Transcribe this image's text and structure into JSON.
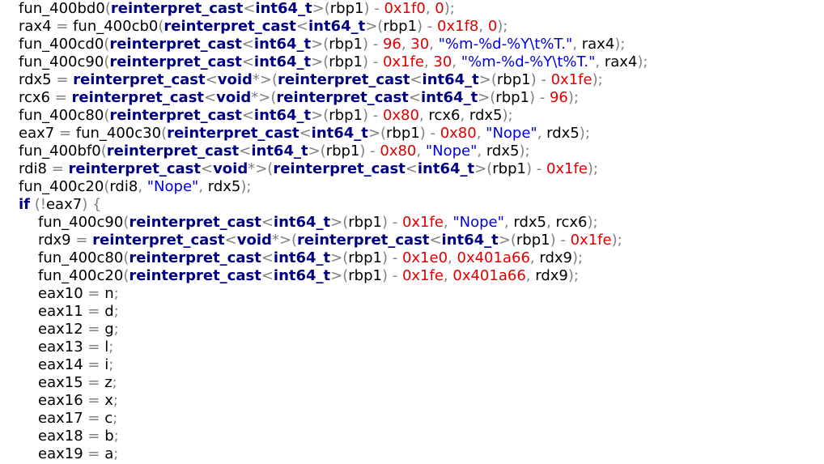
{
  "code_view": {
    "lines": [
      {
        "indent": 0,
        "tokens": [
          [
            "plain",
            "fun_400bd0"
          ],
          [
            "punct",
            "("
          ],
          [
            "kw",
            "reinterpret_cast"
          ],
          [
            "punct",
            "<"
          ],
          [
            "kw",
            "int64_t"
          ],
          [
            "punct",
            ">("
          ],
          [
            "plain",
            "rbp1"
          ],
          [
            "punct",
            ") - "
          ],
          [
            "num",
            "0x1f0"
          ],
          [
            "punct",
            ", "
          ],
          [
            "num",
            "0"
          ],
          [
            "punct",
            ");"
          ]
        ]
      },
      {
        "indent": 0,
        "tokens": [
          [
            "plain",
            "rax4"
          ],
          [
            "punct",
            " = "
          ],
          [
            "plain",
            "fun_400cb0"
          ],
          [
            "punct",
            "("
          ],
          [
            "kw",
            "reinterpret_cast"
          ],
          [
            "punct",
            "<"
          ],
          [
            "kw",
            "int64_t"
          ],
          [
            "punct",
            ">("
          ],
          [
            "plain",
            "rbp1"
          ],
          [
            "punct",
            ") - "
          ],
          [
            "num",
            "0x1f8"
          ],
          [
            "punct",
            ", "
          ],
          [
            "num",
            "0"
          ],
          [
            "punct",
            ");"
          ]
        ]
      },
      {
        "indent": 0,
        "tokens": [
          [
            "plain",
            "fun_400cd0"
          ],
          [
            "punct",
            "("
          ],
          [
            "kw",
            "reinterpret_cast"
          ],
          [
            "punct",
            "<"
          ],
          [
            "kw",
            "int64_t"
          ],
          [
            "punct",
            ">("
          ],
          [
            "plain",
            "rbp1"
          ],
          [
            "punct",
            ") - "
          ],
          [
            "num",
            "96"
          ],
          [
            "punct",
            ", "
          ],
          [
            "num",
            "30"
          ],
          [
            "punct",
            ", "
          ],
          [
            "str",
            "\"%m-%d-%Y\\t%T.\""
          ],
          [
            "punct",
            ", "
          ],
          [
            "plain",
            "rax4"
          ],
          [
            "punct",
            ");"
          ]
        ]
      },
      {
        "indent": 0,
        "tokens": [
          [
            "plain",
            "fun_400c90"
          ],
          [
            "punct",
            "("
          ],
          [
            "kw",
            "reinterpret_cast"
          ],
          [
            "punct",
            "<"
          ],
          [
            "kw",
            "int64_t"
          ],
          [
            "punct",
            ">("
          ],
          [
            "plain",
            "rbp1"
          ],
          [
            "punct",
            ") - "
          ],
          [
            "num",
            "0x1fe"
          ],
          [
            "punct",
            ", "
          ],
          [
            "num",
            "30"
          ],
          [
            "punct",
            ", "
          ],
          [
            "str",
            "\"%m-%d-%Y\\t%T.\""
          ],
          [
            "punct",
            ", "
          ],
          [
            "plain",
            "rax4"
          ],
          [
            "punct",
            ");"
          ]
        ]
      },
      {
        "indent": 0,
        "tokens": [
          [
            "plain",
            "rdx5"
          ],
          [
            "punct",
            " = "
          ],
          [
            "kw",
            "reinterpret_cast"
          ],
          [
            "punct",
            "<"
          ],
          [
            "kw",
            "void"
          ],
          [
            "punct",
            "*>("
          ],
          [
            "kw",
            "reinterpret_cast"
          ],
          [
            "punct",
            "<"
          ],
          [
            "kw",
            "int64_t"
          ],
          [
            "punct",
            ">("
          ],
          [
            "plain",
            "rbp1"
          ],
          [
            "punct",
            ") - "
          ],
          [
            "num",
            "0x1fe"
          ],
          [
            "punct",
            ");"
          ]
        ]
      },
      {
        "indent": 0,
        "tokens": [
          [
            "plain",
            "rcx6"
          ],
          [
            "punct",
            " = "
          ],
          [
            "kw",
            "reinterpret_cast"
          ],
          [
            "punct",
            "<"
          ],
          [
            "kw",
            "void"
          ],
          [
            "punct",
            "*>("
          ],
          [
            "kw",
            "reinterpret_cast"
          ],
          [
            "punct",
            "<"
          ],
          [
            "kw",
            "int64_t"
          ],
          [
            "punct",
            ">("
          ],
          [
            "plain",
            "rbp1"
          ],
          [
            "punct",
            ") - "
          ],
          [
            "num",
            "96"
          ],
          [
            "punct",
            ");"
          ]
        ]
      },
      {
        "indent": 0,
        "tokens": [
          [
            "plain",
            "fun_400c80"
          ],
          [
            "punct",
            "("
          ],
          [
            "kw",
            "reinterpret_cast"
          ],
          [
            "punct",
            "<"
          ],
          [
            "kw",
            "int64_t"
          ],
          [
            "punct",
            ">("
          ],
          [
            "plain",
            "rbp1"
          ],
          [
            "punct",
            ") - "
          ],
          [
            "num",
            "0x80"
          ],
          [
            "punct",
            ", "
          ],
          [
            "plain",
            "rcx6"
          ],
          [
            "punct",
            ", "
          ],
          [
            "plain",
            "rdx5"
          ],
          [
            "punct",
            ");"
          ]
        ]
      },
      {
        "indent": 0,
        "tokens": [
          [
            "plain",
            "eax7"
          ],
          [
            "punct",
            " = "
          ],
          [
            "plain",
            "fun_400c30"
          ],
          [
            "punct",
            "("
          ],
          [
            "kw",
            "reinterpret_cast"
          ],
          [
            "punct",
            "<"
          ],
          [
            "kw",
            "int64_t"
          ],
          [
            "punct",
            ">("
          ],
          [
            "plain",
            "rbp1"
          ],
          [
            "punct",
            ") - "
          ],
          [
            "num",
            "0x80"
          ],
          [
            "punct",
            ", "
          ],
          [
            "str",
            "\"Nope\""
          ],
          [
            "punct",
            ", "
          ],
          [
            "plain",
            "rdx5"
          ],
          [
            "punct",
            ");"
          ]
        ]
      },
      {
        "indent": 0,
        "tokens": [
          [
            "plain",
            "fun_400bf0"
          ],
          [
            "punct",
            "("
          ],
          [
            "kw",
            "reinterpret_cast"
          ],
          [
            "punct",
            "<"
          ],
          [
            "kw",
            "int64_t"
          ],
          [
            "punct",
            ">("
          ],
          [
            "plain",
            "rbp1"
          ],
          [
            "punct",
            ") - "
          ],
          [
            "num",
            "0x80"
          ],
          [
            "punct",
            ", "
          ],
          [
            "str",
            "\"Nope\""
          ],
          [
            "punct",
            ", "
          ],
          [
            "plain",
            "rdx5"
          ],
          [
            "punct",
            ");"
          ]
        ]
      },
      {
        "indent": 0,
        "tokens": [
          [
            "plain",
            "rdi8"
          ],
          [
            "punct",
            " = "
          ],
          [
            "kw",
            "reinterpret_cast"
          ],
          [
            "punct",
            "<"
          ],
          [
            "kw",
            "void"
          ],
          [
            "punct",
            "*>("
          ],
          [
            "kw",
            "reinterpret_cast"
          ],
          [
            "punct",
            "<"
          ],
          [
            "kw",
            "int64_t"
          ],
          [
            "punct",
            ">("
          ],
          [
            "plain",
            "rbp1"
          ],
          [
            "punct",
            ") - "
          ],
          [
            "num",
            "0x1fe"
          ],
          [
            "punct",
            ");"
          ]
        ]
      },
      {
        "indent": 0,
        "tokens": [
          [
            "plain",
            "fun_400c20"
          ],
          [
            "punct",
            "("
          ],
          [
            "plain",
            "rdi8"
          ],
          [
            "punct",
            ", "
          ],
          [
            "str",
            "\"Nope\""
          ],
          [
            "punct",
            ", "
          ],
          [
            "plain",
            "rdx5"
          ],
          [
            "punct",
            ");"
          ]
        ]
      },
      {
        "indent": 0,
        "tokens": [
          [
            "kw",
            "if"
          ],
          [
            "punct",
            " (!"
          ],
          [
            "plain",
            "eax7"
          ],
          [
            "punct",
            ") {"
          ]
        ]
      },
      {
        "indent": 1,
        "tokens": [
          [
            "plain",
            "fun_400c90"
          ],
          [
            "punct",
            "("
          ],
          [
            "kw",
            "reinterpret_cast"
          ],
          [
            "punct",
            "<"
          ],
          [
            "kw",
            "int64_t"
          ],
          [
            "punct",
            ">("
          ],
          [
            "plain",
            "rbp1"
          ],
          [
            "punct",
            ") - "
          ],
          [
            "num",
            "0x1fe"
          ],
          [
            "punct",
            ", "
          ],
          [
            "str",
            "\"Nope\""
          ],
          [
            "punct",
            ", "
          ],
          [
            "plain",
            "rdx5"
          ],
          [
            "punct",
            ", "
          ],
          [
            "plain",
            "rcx6"
          ],
          [
            "punct",
            ");"
          ]
        ]
      },
      {
        "indent": 1,
        "tokens": [
          [
            "plain",
            "rdx9"
          ],
          [
            "punct",
            " = "
          ],
          [
            "kw",
            "reinterpret_cast"
          ],
          [
            "punct",
            "<"
          ],
          [
            "kw",
            "void"
          ],
          [
            "punct",
            "*>("
          ],
          [
            "kw",
            "reinterpret_cast"
          ],
          [
            "punct",
            "<"
          ],
          [
            "kw",
            "int64_t"
          ],
          [
            "punct",
            ">("
          ],
          [
            "plain",
            "rbp1"
          ],
          [
            "punct",
            ") - "
          ],
          [
            "num",
            "0x1fe"
          ],
          [
            "punct",
            ");"
          ]
        ]
      },
      {
        "indent": 1,
        "tokens": [
          [
            "plain",
            "fun_400c80"
          ],
          [
            "punct",
            "("
          ],
          [
            "kw",
            "reinterpret_cast"
          ],
          [
            "punct",
            "<"
          ],
          [
            "kw",
            "int64_t"
          ],
          [
            "punct",
            ">("
          ],
          [
            "plain",
            "rbp1"
          ],
          [
            "punct",
            ") - "
          ],
          [
            "num",
            "0x1e0"
          ],
          [
            "punct",
            ", "
          ],
          [
            "num",
            "0x401a66"
          ],
          [
            "punct",
            ", "
          ],
          [
            "plain",
            "rdx9"
          ],
          [
            "punct",
            ");"
          ]
        ]
      },
      {
        "indent": 1,
        "tokens": [
          [
            "plain",
            "fun_400c20"
          ],
          [
            "punct",
            "("
          ],
          [
            "kw",
            "reinterpret_cast"
          ],
          [
            "punct",
            "<"
          ],
          [
            "kw",
            "int64_t"
          ],
          [
            "punct",
            ">("
          ],
          [
            "plain",
            "rbp1"
          ],
          [
            "punct",
            ") - "
          ],
          [
            "num",
            "0x1fe"
          ],
          [
            "punct",
            ", "
          ],
          [
            "num",
            "0x401a66"
          ],
          [
            "punct",
            ", "
          ],
          [
            "plain",
            "rdx9"
          ],
          [
            "punct",
            ");"
          ]
        ]
      },
      {
        "indent": 1,
        "tokens": [
          [
            "plain",
            "eax10"
          ],
          [
            "punct",
            " = "
          ],
          [
            "plain",
            "n"
          ],
          [
            "punct",
            ";"
          ]
        ]
      },
      {
        "indent": 1,
        "tokens": [
          [
            "plain",
            "eax11"
          ],
          [
            "punct",
            " = "
          ],
          [
            "plain",
            "d"
          ],
          [
            "punct",
            ";"
          ]
        ]
      },
      {
        "indent": 1,
        "tokens": [
          [
            "plain",
            "eax12"
          ],
          [
            "punct",
            " = "
          ],
          [
            "plain",
            "g"
          ],
          [
            "punct",
            ";"
          ]
        ]
      },
      {
        "indent": 1,
        "tokens": [
          [
            "plain",
            "eax13"
          ],
          [
            "punct",
            " = "
          ],
          [
            "plain",
            "l"
          ],
          [
            "punct",
            ";"
          ]
        ]
      },
      {
        "indent": 1,
        "tokens": [
          [
            "plain",
            "eax14"
          ],
          [
            "punct",
            " = "
          ],
          [
            "plain",
            "i"
          ],
          [
            "punct",
            ";"
          ]
        ]
      },
      {
        "indent": 1,
        "tokens": [
          [
            "plain",
            "eax15"
          ],
          [
            "punct",
            " = "
          ],
          [
            "plain",
            "z"
          ],
          [
            "punct",
            ";"
          ]
        ]
      },
      {
        "indent": 1,
        "tokens": [
          [
            "plain",
            "eax16"
          ],
          [
            "punct",
            " = "
          ],
          [
            "plain",
            "x"
          ],
          [
            "punct",
            ";"
          ]
        ]
      },
      {
        "indent": 1,
        "tokens": [
          [
            "plain",
            "eax17"
          ],
          [
            "punct",
            " = "
          ],
          [
            "plain",
            "c"
          ],
          [
            "punct",
            ";"
          ]
        ]
      },
      {
        "indent": 1,
        "tokens": [
          [
            "plain",
            "eax18"
          ],
          [
            "punct",
            " = "
          ],
          [
            "plain",
            "b"
          ],
          [
            "punct",
            ";"
          ]
        ]
      },
      {
        "indent": 1,
        "tokens": [
          [
            "plain",
            "eax19"
          ],
          [
            "punct",
            " = "
          ],
          [
            "plain",
            "a"
          ],
          [
            "punct",
            ";"
          ]
        ]
      }
    ]
  }
}
